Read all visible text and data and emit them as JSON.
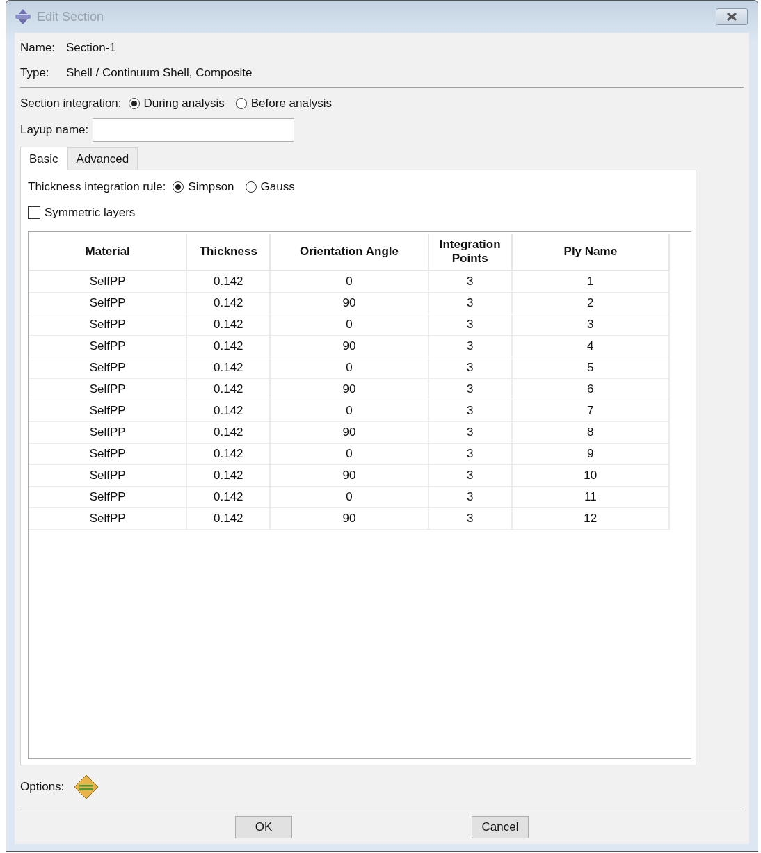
{
  "window": {
    "title": "Edit Section"
  },
  "name": {
    "label": "Name:",
    "value": "Section-1"
  },
  "type": {
    "label": "Type:",
    "value": "Shell / Continuum Shell, Composite"
  },
  "section_integration": {
    "label": "Section integration:",
    "options": [
      {
        "label": "During analysis",
        "selected": true
      },
      {
        "label": "Before analysis",
        "selected": false
      }
    ]
  },
  "layup_name": {
    "label": "Layup name:"
  },
  "tabs": [
    {
      "label": "Basic",
      "selected": true
    },
    {
      "label": "Advanced",
      "selected": false
    }
  ],
  "thickness_rule": {
    "label": "Thickness integration rule:",
    "options": [
      {
        "label": "Simpson",
        "selected": true
      },
      {
        "label": "Gauss",
        "selected": false
      }
    ]
  },
  "symmetric_layers": {
    "label": "Symmetric layers",
    "checked": false
  },
  "table": {
    "columns": [
      "Material",
      "Thickness",
      "Orientation Angle",
      "Integration Points",
      "Ply Name"
    ],
    "rows": [
      [
        "SelfPP",
        "0.142",
        "0",
        "3",
        "1"
      ],
      [
        "SelfPP",
        "0.142",
        "90",
        "3",
        "2"
      ],
      [
        "SelfPP",
        "0.142",
        "0",
        "3",
        "3"
      ],
      [
        "SelfPP",
        "0.142",
        "90",
        "3",
        "4"
      ],
      [
        "SelfPP",
        "0.142",
        "0",
        "3",
        "5"
      ],
      [
        "SelfPP",
        "0.142",
        "90",
        "3",
        "6"
      ],
      [
        "SelfPP",
        "0.142",
        "0",
        "3",
        "7"
      ],
      [
        "SelfPP",
        "0.142",
        "90",
        "3",
        "8"
      ],
      [
        "SelfPP",
        "0.142",
        "0",
        "3",
        "9"
      ],
      [
        "SelfPP",
        "0.142",
        "90",
        "3",
        "10"
      ],
      [
        "SelfPP",
        "0.142",
        "0",
        "3",
        "11"
      ],
      [
        "SelfPP",
        "0.142",
        "90",
        "3",
        "12"
      ]
    ]
  },
  "options": {
    "label": "Options:"
  },
  "buttons": [
    "OK",
    "Cancel"
  ]
}
